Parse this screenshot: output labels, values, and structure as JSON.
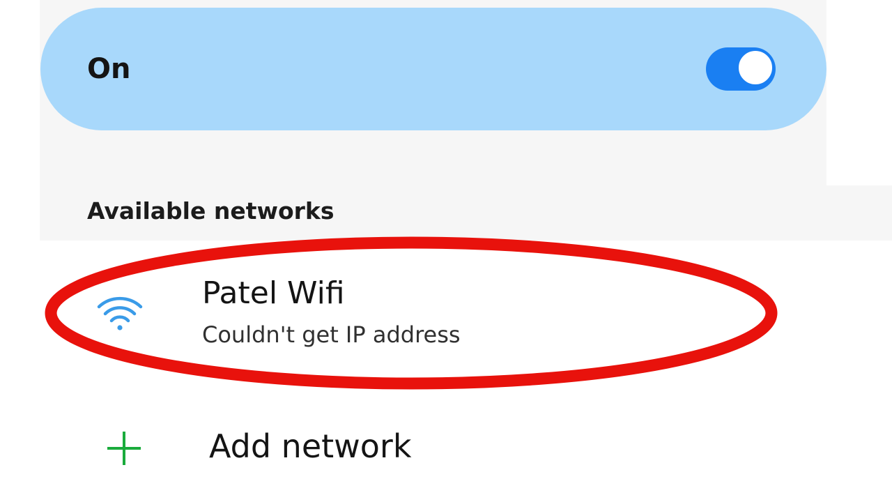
{
  "master_toggle": {
    "label": "On",
    "state": "on",
    "accent_color": "#1a7ff2",
    "row_color": "#a8d8fb"
  },
  "available_networks": {
    "header": "Available networks",
    "items": [
      {
        "name": "Patel Wifi",
        "status": "Couldn't get IP address",
        "icon": "wifi-icon",
        "icon_color": "#3a9be8",
        "highlighted": true
      }
    ]
  },
  "add_network": {
    "label": "Add network",
    "icon": "plus-icon",
    "icon_color": "#1aab3c"
  },
  "highlight_color": "#e8120c"
}
